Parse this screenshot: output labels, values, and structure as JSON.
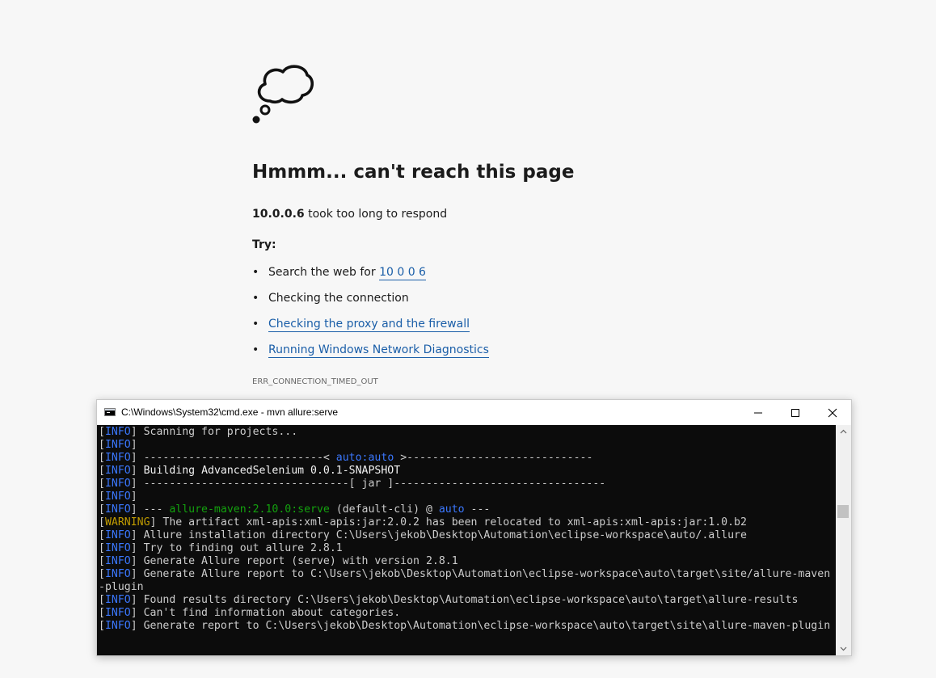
{
  "error": {
    "title": "Hmmm... can't reach this page",
    "host": "10.0.0.6",
    "host_message": " took too long to respond",
    "try_label": "Try:",
    "suggestions": [
      {
        "prefix": "Search the web for ",
        "link": "10 0 0 6"
      },
      {
        "text": "Checking the connection"
      },
      {
        "link": "Checking the proxy and the firewall"
      },
      {
        "link": "Running Windows Network Diagnostics"
      }
    ],
    "code": "ERR_CONNECTION_TIMED_OUT",
    "link_color": "#1a5ea8",
    "icon": "thought-cloud-icon"
  },
  "terminal": {
    "title": "C:\\Windows\\System32\\cmd.exe - mvn  allure:serve",
    "buttons": {
      "minimize": "minimize-icon",
      "maximize": "maximize-icon",
      "close": "close-icon"
    },
    "scroll_position": 0.35,
    "colors": {
      "background": "#0c0c0c",
      "text": "#cccccc",
      "info": "#3b78ff",
      "warning": "#c19c00",
      "green": "#13a10e"
    },
    "lines": [
      [
        {
          "t": "["
        },
        {
          "t": "INFO",
          "c": "info"
        },
        {
          "t": "] Scanning for projects..."
        }
      ],
      [
        {
          "t": "["
        },
        {
          "t": "INFO",
          "c": "info"
        },
        {
          "t": "]"
        }
      ],
      [
        {
          "t": "["
        },
        {
          "t": "INFO",
          "c": "info"
        },
        {
          "t": "] ----------------------------< "
        },
        {
          "t": "auto:auto",
          "c": "blue"
        },
        {
          "t": " >-----------------------------"
        }
      ],
      [
        {
          "t": "["
        },
        {
          "t": "INFO",
          "c": "info"
        },
        {
          "t": "] "
        },
        {
          "t": "Building AdvancedSelenium 0.0.1-SNAPSHOT",
          "c": "bright"
        }
      ],
      [
        {
          "t": "["
        },
        {
          "t": "INFO",
          "c": "info"
        },
        {
          "t": "] --------------------------------[ jar ]---------------------------------"
        }
      ],
      [
        {
          "t": "["
        },
        {
          "t": "INFO",
          "c": "info"
        },
        {
          "t": "]"
        }
      ],
      [
        {
          "t": "["
        },
        {
          "t": "INFO",
          "c": "info"
        },
        {
          "t": "] --- "
        },
        {
          "t": "allure-maven:2.10.0:serve",
          "c": "green"
        },
        {
          "t": " (default-cli) @ "
        },
        {
          "t": "auto",
          "c": "blue"
        },
        {
          "t": " ---"
        }
      ],
      [
        {
          "t": "["
        },
        {
          "t": "WARNING",
          "c": "warn"
        },
        {
          "t": "] The artifact xml-apis:xml-apis:jar:2.0.2 has been relocated to xml-apis:xml-apis:jar:1.0.b2"
        }
      ],
      [
        {
          "t": "["
        },
        {
          "t": "INFO",
          "c": "info"
        },
        {
          "t": "] Allure installation directory C:\\Users\\jekob\\Desktop\\Automation\\eclipse-workspace\\auto/.allure"
        }
      ],
      [
        {
          "t": "["
        },
        {
          "t": "INFO",
          "c": "info"
        },
        {
          "t": "] Try to finding out allure 2.8.1"
        }
      ],
      [
        {
          "t": "["
        },
        {
          "t": "INFO",
          "c": "info"
        },
        {
          "t": "] Generate Allure report (serve) with version 2.8.1"
        }
      ],
      [
        {
          "t": "["
        },
        {
          "t": "INFO",
          "c": "info"
        },
        {
          "t": "] Generate Allure report to C:\\Users\\jekob\\Desktop\\Automation\\eclipse-workspace\\auto\\target\\site/allure-maven"
        }
      ],
      [
        {
          "t": "-plugin"
        }
      ],
      [
        {
          "t": "["
        },
        {
          "t": "INFO",
          "c": "info"
        },
        {
          "t": "] Found results directory C:\\Users\\jekob\\Desktop\\Automation\\eclipse-workspace\\auto\\target\\allure-results"
        }
      ],
      [
        {
          "t": "["
        },
        {
          "t": "INFO",
          "c": "info"
        },
        {
          "t": "] Can't find information about categories."
        }
      ],
      [
        {
          "t": "["
        },
        {
          "t": "INFO",
          "c": "info"
        },
        {
          "t": "] Generate report to C:\\Users\\jekob\\Desktop\\Automation\\eclipse-workspace\\auto\\target\\site\\allure-maven-plugin"
        }
      ]
    ]
  }
}
